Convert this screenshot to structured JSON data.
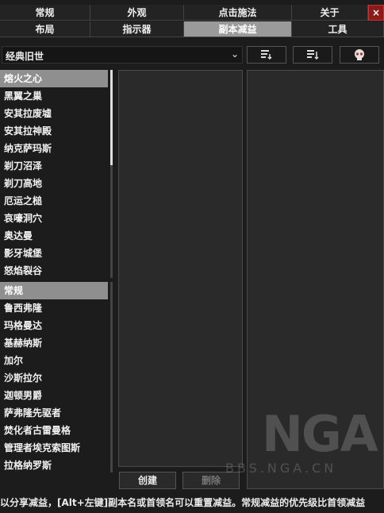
{
  "tabs_row1": [
    {
      "label": "常规",
      "active": false
    },
    {
      "label": "外观",
      "active": false
    },
    {
      "label": "点击施法",
      "active": false
    },
    {
      "label": "关于",
      "active": false
    }
  ],
  "tabs_row2": [
    {
      "label": "布局",
      "active": false
    },
    {
      "label": "指示器",
      "active": false
    },
    {
      "label": "副本减益",
      "active": true
    },
    {
      "label": "工具",
      "active": false
    }
  ],
  "close_label": "×",
  "toolbar": {
    "dropdown_value": "经典旧世",
    "chevron": "⌄",
    "btn1_icon": "sort-down-icon",
    "btn2_icon": "export-icon",
    "btn3_icon": "skull-icon"
  },
  "dungeons": [
    "熔火之心",
    "黑翼之巢",
    "安其拉废墟",
    "安其拉神殿",
    "纳克萨玛斯",
    "剃刀沼泽",
    "剃刀高地",
    "厄运之槌",
    "哀嚎洞穴",
    "奥达曼",
    "影牙城堡",
    "怒焰裂谷"
  ],
  "selected_dungeon": 0,
  "bosses": [
    "常规",
    "鲁西弗隆",
    "玛格曼达",
    "基赫纳斯",
    "加尔",
    "沙斯拉尔",
    "迦顿男爵",
    "萨弗隆先驱者",
    "焚化者古雷曼格",
    "管理者埃克索图斯",
    "拉格纳罗斯"
  ],
  "selected_boss": 0,
  "buttons": {
    "create": "创建",
    "delete": "删除"
  },
  "status_text": "以分享减益，[Alt+左键]副本名或首领名可以重置减益。常规减益的优先级比首领减益",
  "watermark": {
    "logo": "NGA",
    "site": "BBS.NGA.CN"
  }
}
